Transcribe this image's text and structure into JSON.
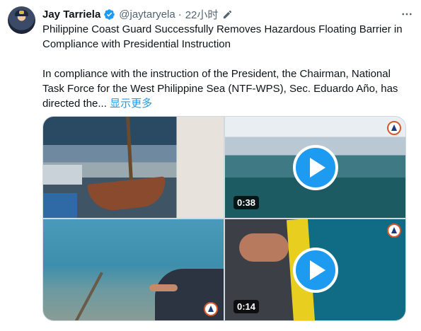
{
  "author": {
    "name": "Jay Tarriela",
    "handle": "@jaytaryela",
    "separator": "·",
    "time": "22小时"
  },
  "tweet": {
    "headline": "Philippine Coast Guard Successfully Removes Hazardous Floating Barrier in Compliance with Presidential Instruction",
    "body": "In compliance with the instruction of the President, the Chairman, National Task Force for the West Philippine Sea (NTF-WPS), Sec. Eduardo Año, has directed the...",
    "show_more": "显示更多"
  },
  "icons": {
    "verified": "verified-badge-icon",
    "edit": "edit-pencil-icon",
    "more": "more-options-icon",
    "play": "play-icon",
    "logo": "coast-guard-logo"
  },
  "media": {
    "videos": [
      {
        "duration": "0:38"
      },
      {
        "duration": "0:14"
      }
    ]
  },
  "colors": {
    "accent": "#1d9bf0",
    "text": "#0f1419",
    "secondary": "#536471",
    "border": "#cfd9de"
  }
}
